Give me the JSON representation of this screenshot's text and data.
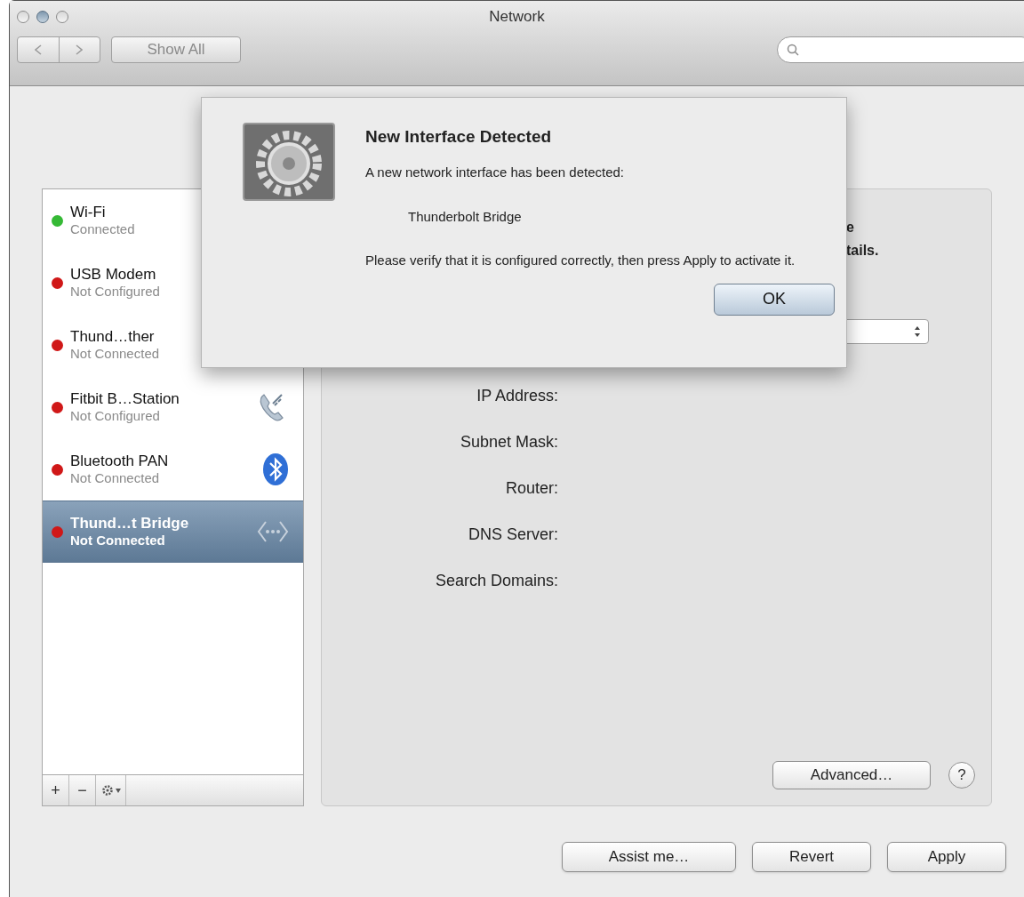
{
  "window": {
    "title": "Network"
  },
  "toolbar": {
    "show_all": "Show All"
  },
  "services": [
    {
      "name": "Wi-Fi",
      "status": "Connected",
      "color": "#35b935",
      "selected": false
    },
    {
      "name": "USB Modem",
      "status": "Not Configured",
      "color": "#d01818",
      "selected": false
    },
    {
      "name": "Thund…ther",
      "status": "Not Connected",
      "color": "#d01818",
      "selected": false
    },
    {
      "name": "Fitbit B…Station",
      "status": "Not Configured",
      "color": "#d01818",
      "selected": false,
      "kind": "phone"
    },
    {
      "name": "Bluetooth PAN",
      "status": "Not Connected",
      "color": "#d01818",
      "selected": false,
      "kind": "bluetooth"
    },
    {
      "name": "Thund…t Bridge",
      "status": "Not Connected",
      "color": "#d01818",
      "selected": true,
      "kind": "bridge"
    }
  ],
  "list_toolbar": {
    "add": "+",
    "remove": "−"
  },
  "details": {
    "status_note": [
      "e",
      "tails."
    ],
    "fields": [
      {
        "label": "IP Address:"
      },
      {
        "label": "Subnet Mask:"
      },
      {
        "label": "Router:"
      },
      {
        "label": "DNS Server:"
      },
      {
        "label": "Search Domains:"
      }
    ],
    "advanced": "Advanced…",
    "help": "?"
  },
  "buttons": [
    "Assist me…",
    "Revert",
    "Apply"
  ],
  "dialog": {
    "title": "New Interface Detected",
    "message": "A new network interface has been detected:",
    "interface": "Thunderbolt Bridge",
    "instruction": "Please verify that it is configured correctly, then press Apply to activate it.",
    "button": "OK"
  }
}
